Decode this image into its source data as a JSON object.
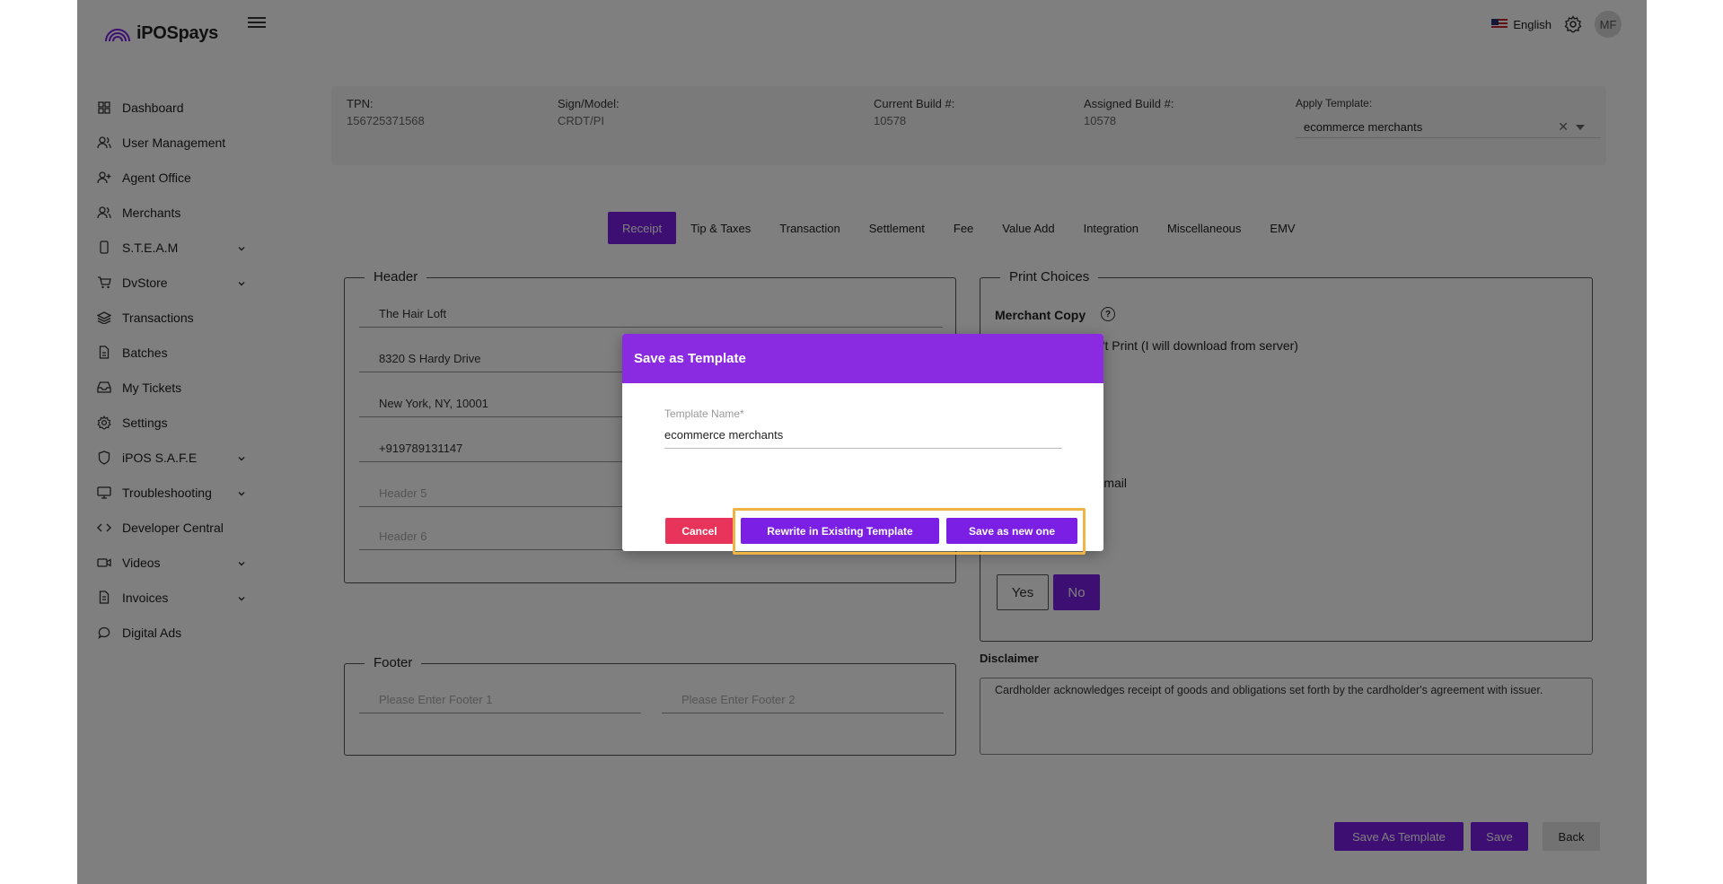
{
  "app": {
    "name": "iPOSpays",
    "brand_color": "#7b1fe4"
  },
  "header": {
    "language": "English",
    "avatar_initials": "MF"
  },
  "sidebar": {
    "items": [
      {
        "label": "Dashboard",
        "icon": "dashboard-icon",
        "expandable": false
      },
      {
        "label": "User Management",
        "icon": "user-management-icon",
        "expandable": false
      },
      {
        "label": "Agent Office",
        "icon": "agent-office-icon",
        "expandable": false
      },
      {
        "label": "Merchants",
        "icon": "merchants-icon",
        "expandable": false
      },
      {
        "label": "S.T.E.A.M",
        "icon": "phone-icon",
        "expandable": true
      },
      {
        "label": "DvStore",
        "icon": "cart-icon",
        "expandable": true
      },
      {
        "label": "Transactions",
        "icon": "layers-icon",
        "expandable": false
      },
      {
        "label": "Batches",
        "icon": "document-icon",
        "expandable": false
      },
      {
        "label": "My Tickets",
        "icon": "inbox-icon",
        "expandable": false
      },
      {
        "label": "Settings",
        "icon": "gear-icon",
        "expandable": false
      },
      {
        "label": "iPOS S.A.F.E",
        "icon": "shield-icon",
        "expandable": true
      },
      {
        "label": "Troubleshooting",
        "icon": "monitor-icon",
        "expandable": true
      },
      {
        "label": "Developer Central",
        "icon": "code-icon",
        "expandable": false
      },
      {
        "label": "Videos",
        "icon": "video-icon",
        "expandable": true
      },
      {
        "label": "Invoices",
        "icon": "invoice-icon",
        "expandable": true
      },
      {
        "label": "Digital Ads",
        "icon": "chat-icon",
        "expandable": false
      }
    ]
  },
  "info": {
    "tpn_label": "TPN:",
    "tpn_value": "156725371568",
    "model_label": "Sign/Model:",
    "model_value": "CRDT/PI",
    "current_build_label": "Current Build #:",
    "current_build_value": "10578",
    "assigned_build_label": "Assigned Build #:",
    "assigned_build_value": "10578",
    "apply_template_label": "Apply Template:",
    "apply_template_value": "ecommerce merchants"
  },
  "tabs": [
    "Receipt",
    "Tip & Taxes",
    "Transaction",
    "Settlement",
    "Fee",
    "Value Add",
    "Integration",
    "Miscellaneous",
    "EMV"
  ],
  "active_tab": "Receipt",
  "header_section": {
    "legend": "Header",
    "lines": [
      "The Hair Loft",
      "8320 S Hardy Drive",
      "New York, NY, 10001",
      "+919789131147"
    ],
    "placeholders": [
      "Header 5",
      "Header 6"
    ]
  },
  "print_choices": {
    "legend": "Print Choices",
    "merchant_copy_label": "Merchant Copy",
    "option_dont_print": "n't Print (I will download from server)",
    "option_email": "Email",
    "yes_label": "Yes",
    "no_label": "No"
  },
  "footer_section": {
    "legend": "Footer",
    "placeholder_1": "Please Enter Footer 1",
    "placeholder_2": "Please Enter Footer 2"
  },
  "disclaimer": {
    "label": "Disclaimer",
    "text": "Cardholder acknowledges receipt of goods and obligations set forth by the cardholder's agreement with issuer."
  },
  "actions": {
    "save_as_template": "Save As Template",
    "save": "Save",
    "back": "Back"
  },
  "modal": {
    "title": "Save as Template",
    "field_label": "Template Name*",
    "field_value": "ecommerce merchants",
    "cancel": "Cancel",
    "rewrite": "Rewrite in Existing Template",
    "save_new": "Save as new one"
  }
}
